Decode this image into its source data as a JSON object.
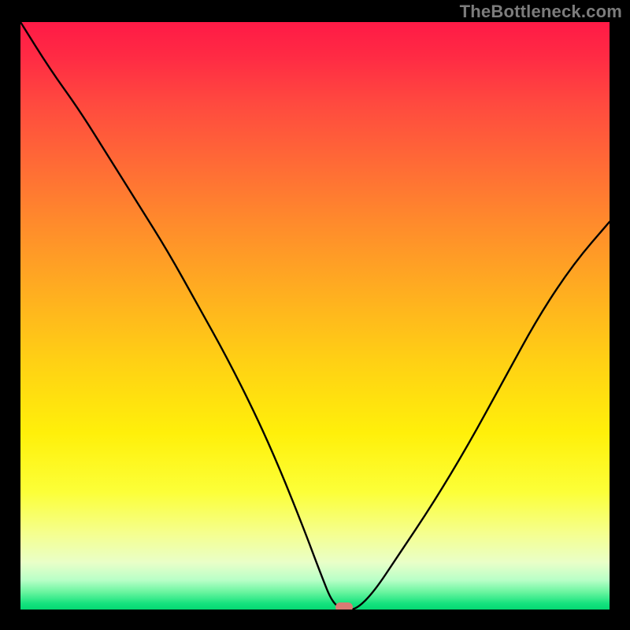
{
  "watermark": "TheBottleneck.com",
  "colors": {
    "page_bg": "#000000",
    "watermark": "#7c7c7c",
    "curve": "#000000",
    "marker": "#d87b74",
    "gradient_top": "#ff1a46",
    "gradient_bottom": "#05d873"
  },
  "chart_data": {
    "type": "line",
    "title": "",
    "xlabel": "",
    "ylabel": "",
    "xlim": [
      0,
      100
    ],
    "ylim": [
      0,
      100
    ],
    "grid": false,
    "legend": false,
    "series": [
      {
        "name": "bottleneck_curve",
        "x": [
          0,
          5,
          10,
          15,
          20,
          25,
          30,
          35,
          40,
          44,
          48,
          51,
          53,
          55,
          57,
          60,
          64,
          70,
          76,
          82,
          88,
          94,
          100
        ],
        "values": [
          100,
          92,
          85,
          77,
          69,
          61,
          52,
          43,
          33,
          24,
          14,
          6,
          1,
          0,
          0,
          3,
          9,
          18,
          28,
          39,
          50,
          59,
          66
        ]
      }
    ],
    "marker": {
      "x": 55,
      "y": 0
    }
  }
}
